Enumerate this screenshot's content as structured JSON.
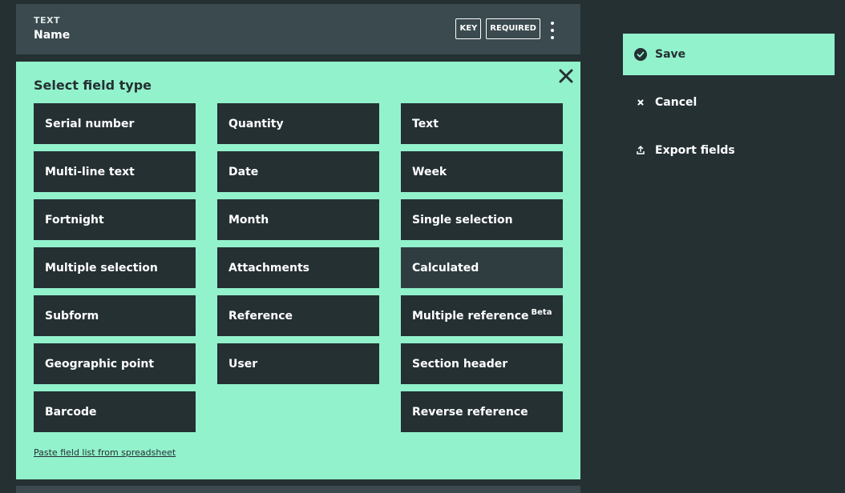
{
  "field_card": {
    "type_label": "TEXT",
    "name": "Name",
    "badges": [
      "KEY",
      "REQUIRED"
    ]
  },
  "panel": {
    "title": "Select field type",
    "paste_link": "Paste field list from spreadsheet",
    "columns": [
      [
        "Serial number",
        "Multi-line text",
        "Fortnight",
        "Multiple selection",
        "Subform",
        "Geographic point",
        "Barcode"
      ],
      [
        "Quantity",
        "Date",
        "Month",
        "Attachments",
        "Reference",
        "User"
      ],
      [
        "Text",
        "Week",
        "Single selection",
        "Calculated",
        "Multiple reference",
        "Section header",
        "Reverse reference"
      ]
    ],
    "beta_label": "Beta"
  },
  "actions": {
    "save": "Save",
    "cancel": "Cancel",
    "export": "Export fields"
  },
  "colors": {
    "background": "#253033",
    "accent": "#92f2cc",
    "card": "#3a4a4e"
  }
}
